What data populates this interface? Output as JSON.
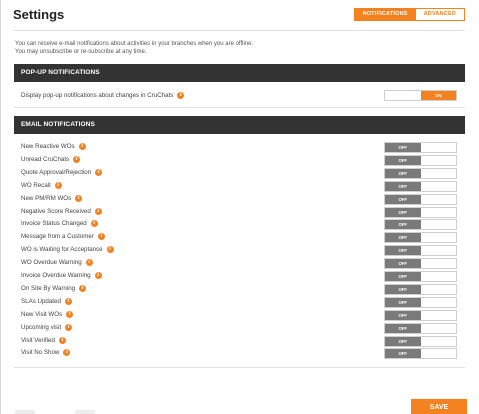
{
  "header": {
    "title": "Settings",
    "tabs": [
      {
        "label": "NOTIFICATIONS",
        "active": true
      },
      {
        "label": "ADVANCED",
        "active": false
      }
    ]
  },
  "intro": {
    "line1": "You can receive e-mail notifications about activities in your branches when you are offline.",
    "line2": "You may unsubscribe or re-subscribe at any time."
  },
  "popup": {
    "section_title": "POP-UP NOTIFICATIONS",
    "row": {
      "label": "Display pop-up notifications about changes in CruChats",
      "state": "ON",
      "icon": "info-icon"
    }
  },
  "email": {
    "section_title": "EMAIL NOTIFICATIONS",
    "rows": [
      {
        "label": "New Reactive WOs",
        "state": "OFF"
      },
      {
        "label": "Unread CruChats",
        "state": "OFF"
      },
      {
        "label": "Quote Approval/Rejection",
        "state": "OFF"
      },
      {
        "label": "WO Recall",
        "state": "OFF"
      },
      {
        "label": "New PM/RM WOs",
        "state": "OFF"
      },
      {
        "label": "Negative Score Received",
        "state": "OFF"
      },
      {
        "label": "Invoice Status Changed",
        "state": "OFF"
      },
      {
        "label": "Message from a Customer",
        "state": "OFF"
      },
      {
        "label": "WO is Waiting for Acceptance",
        "state": "OFF"
      },
      {
        "label": "WO Overdue Warning",
        "state": "OFF"
      },
      {
        "label": "Invoice Overdue Warning",
        "state": "OFF"
      },
      {
        "label": "On Site By Warning",
        "state": "OFF"
      },
      {
        "label": "SLAs Updated",
        "state": "OFF"
      },
      {
        "label": "New Visit WOs",
        "state": "OFF"
      },
      {
        "label": "Upcoming visit",
        "state": "OFF"
      },
      {
        "label": "Visit Verified",
        "state": "OFF"
      },
      {
        "label": "Visit No Show",
        "state": "OFF"
      }
    ]
  },
  "footer": {
    "save_label": "SAVE"
  },
  "colors": {
    "accent": "#f58220",
    "section_bar": "#333333",
    "toggle_off": "#7a7a7a"
  }
}
